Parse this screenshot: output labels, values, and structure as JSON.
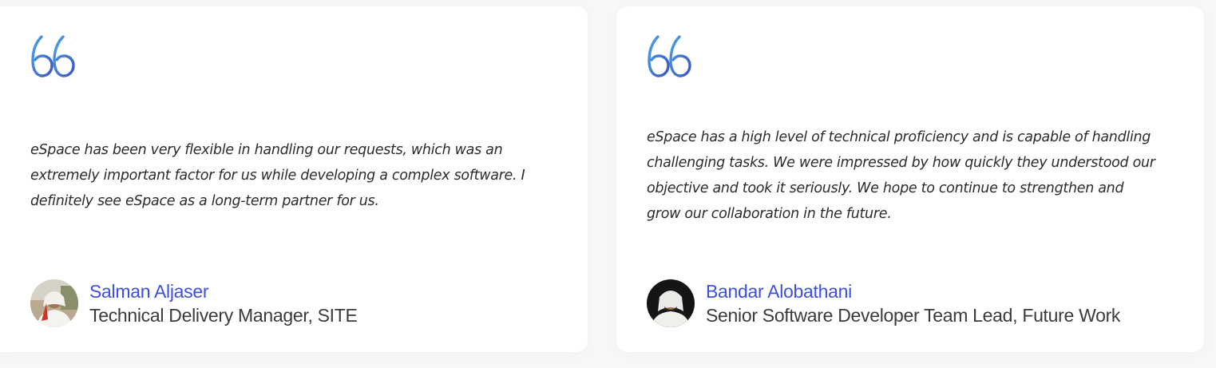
{
  "colors": {
    "accent": "#3c4fe0",
    "quote_gradient_start": "#4a8fe0",
    "quote_gradient_end": "#3c4fb0",
    "text": "#2b2b2b",
    "background": "#f7f7f9"
  },
  "testimonials": [
    {
      "icon": "quote-icon",
      "quote": "eSpace has been very flexible in handling our requests, which was an extremely important factor for us while developing a complex software. I definitely see eSpace as a long-term partner for us.",
      "author_name": "Salman Aljaser",
      "author_role": "Technical Delivery Manager, SITE"
    },
    {
      "icon": "quote-icon",
      "quote": "eSpace has a high level of technical proficiency and is capable of handling challenging tasks. We were impressed by how quickly they understood our objective and took it seriously. We hope to continue to strengthen and grow our collaboration in the future.",
      "author_name": "Bandar Alobathani",
      "author_role": "Senior Software Developer Team Lead, Future Work"
    }
  ]
}
